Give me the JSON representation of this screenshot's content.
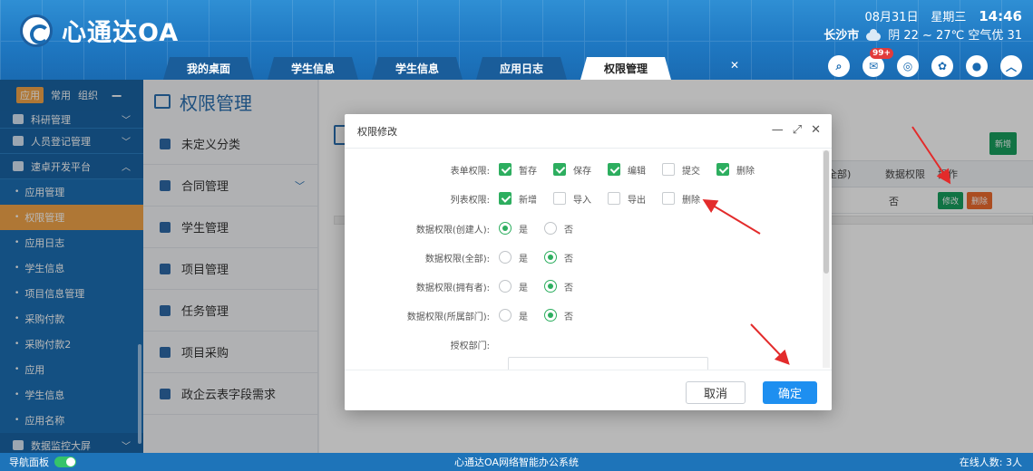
{
  "header": {
    "logo_text": "心通达OA",
    "date": "08月31日",
    "weekday": "星期三",
    "time": "14:46",
    "city": "长沙市",
    "weather": "阴 22 ~ 27℃ 空气优 31",
    "tabs": [
      "我的桌面",
      "学生信息",
      "学生信息",
      "应用日志",
      "权限管理"
    ],
    "active_tab": 4,
    "notification_badge": "99+",
    "accent_color": "#1f78c2"
  },
  "sidebar": {
    "tabs": [
      "应用",
      "常用",
      "组织"
    ],
    "items": [
      {
        "label": "科研管理",
        "type": "group"
      },
      {
        "label": "人员登记管理",
        "type": "group"
      },
      {
        "label": "速卓开发平台",
        "type": "group"
      },
      {
        "label": "应用管理",
        "type": "sub"
      },
      {
        "label": "权限管理",
        "type": "sub",
        "active": true
      },
      {
        "label": "应用日志",
        "type": "sub"
      },
      {
        "label": "学生信息",
        "type": "sub"
      },
      {
        "label": "项目信息管理",
        "type": "sub"
      },
      {
        "label": "采购付款",
        "type": "sub"
      },
      {
        "label": "采购付款2",
        "type": "sub"
      },
      {
        "label": "应用",
        "type": "sub"
      },
      {
        "label": "学生信息",
        "type": "sub"
      },
      {
        "label": "应用名称",
        "type": "sub"
      },
      {
        "label": "数据监控大屏",
        "type": "group"
      }
    ]
  },
  "subpanel": {
    "title": "权限管理",
    "items": [
      "未定义分类",
      "合同管理",
      "学生管理",
      "项目管理",
      "任务管理",
      "项目采购",
      "政企云表字段需求"
    ]
  },
  "content": {
    "new_button": "新增",
    "columns": [
      "全部)",
      "数据权限",
      "操作"
    ],
    "row": {
      "data_perm": "否",
      "edit": "修改",
      "delete": "删除"
    }
  },
  "modal": {
    "title": "权限修改",
    "form_perm_label": "表单权限:",
    "form_perms": [
      {
        "label": "暂存",
        "checked": true
      },
      {
        "label": "保存",
        "checked": true
      },
      {
        "label": "编辑",
        "checked": true
      },
      {
        "label": "提交",
        "checked": false
      },
      {
        "label": "删除",
        "checked": true
      }
    ],
    "list_perm_label": "列表权限:",
    "list_perms": [
      {
        "label": "新增",
        "checked": true
      },
      {
        "label": "导入",
        "checked": false
      },
      {
        "label": "导出",
        "checked": false
      },
      {
        "label": "删除",
        "checked": false
      }
    ],
    "yes": "是",
    "no": "否",
    "data_perms": [
      {
        "label": "数据权限(创建人):",
        "value": "yes"
      },
      {
        "label": "数据权限(全部):",
        "value": "no"
      },
      {
        "label": "数据权限(拥有者):",
        "value": "no"
      },
      {
        "label": "数据权限(所属部门):",
        "value": "no"
      }
    ],
    "dept_label": "授权部门:",
    "cancel": "取消",
    "confirm": "确定"
  },
  "footer": {
    "nav_panel": "导航面板",
    "center": "心通达OA网络智能办公系统",
    "online": "在线人数: 3人"
  }
}
